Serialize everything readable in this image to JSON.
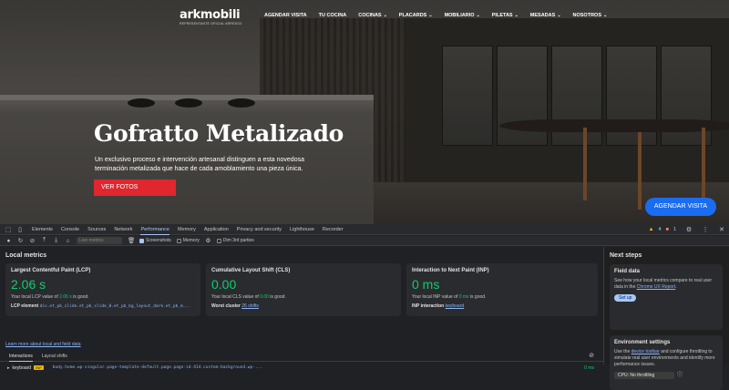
{
  "site": {
    "logo": "arkmobili",
    "logo_sub": "REPRESENTANTE OFICIAL ARREDO3",
    "nav": [
      {
        "label": "AGENDAR VISITA",
        "caret": false
      },
      {
        "label": "TU COCINA",
        "caret": false
      },
      {
        "label": "COCINAS",
        "caret": true
      },
      {
        "label": "PLACARDS",
        "caret": true
      },
      {
        "label": "MOBILIARIO",
        "caret": true
      },
      {
        "label": "PILETAS",
        "caret": true
      },
      {
        "label": "MESADAS",
        "caret": true
      },
      {
        "label": "NOSOTROS",
        "caret": true
      }
    ],
    "hero_title": "Gofratto Metalizado",
    "hero_desc": "Un exclusivo proceso e intervención artesanal distinguen a esta novedosa terminación metalizada que hace de cada amoblamiento una pieza única.",
    "cta": "VER FOTOS",
    "floating_cta": "AGENDAR VISITA"
  },
  "devtools": {
    "tabs": [
      "Elements",
      "Console",
      "Sources",
      "Network",
      "Performance",
      "Memory",
      "Application",
      "Privacy and security",
      "Lighthouse",
      "Recorder"
    ],
    "active_tab": "Performance",
    "warnings": "4",
    "errors": "1",
    "toolbar": {
      "select_placeholder": "Live metrics",
      "screenshots": "Screenshots",
      "memory": "Memory",
      "dim": "Dim 3rd parties"
    },
    "local_metrics_title": "Local metrics",
    "cards": [
      {
        "title": "Largest Contentful Paint (LCP)",
        "value": "2.06 s",
        "desc_pre": "Your local LCP value of ",
        "desc_val": "2.06 s",
        "desc_post": " is good.",
        "extra_label": "LCP element",
        "extra_value": "div.et_pb_slide.et_pb_slide_0.et_pb_bg_layout_dark.et_pb_m..."
      },
      {
        "title": "Cumulative Layout Shift (CLS)",
        "value": "0.00",
        "desc_pre": "Your local CLS value of ",
        "desc_val": "0.00",
        "desc_post": " is good.",
        "extra_label": "Worst cluster",
        "extra_value": "26 shifts"
      },
      {
        "title": "Interaction to Next Paint (INP)",
        "value": "0 ms",
        "desc_pre": "Your local INP value of ",
        "desc_val": "0 ms",
        "desc_post": " is good.",
        "extra_label": "INP interaction",
        "extra_value": "keyboard"
      }
    ],
    "learn_more": "Learn more about local and field data",
    "subtabs": [
      "Interactions",
      "Layout shifts"
    ],
    "interaction": {
      "type": "keyboard",
      "badge": "INP",
      "selector": "body.home.wp-singular.page-template-default.page.page-id-414.custom-background.wp-...",
      "duration": "0 ms"
    },
    "next_steps": {
      "title": "Next steps",
      "field_data_title": "Field data",
      "field_data_desc_pre": "See how your local metrics compare to real user data in the ",
      "field_data_link": "Chrome UX Report",
      "field_data_desc_post": ".",
      "setup": "Set up",
      "env_title": "Environment settings",
      "env_desc_pre": "Use the ",
      "env_link": "device toolbar",
      "env_desc_post": " and configure throttling to simulate real user environments and identify more performance issues.",
      "cpu": "CPU: No throttling"
    }
  },
  "colors": {
    "good": "#0cce6b",
    "accent": "#a8c7fa",
    "cta_red": "#e0262e",
    "cta_blue": "#1a6cf0"
  }
}
